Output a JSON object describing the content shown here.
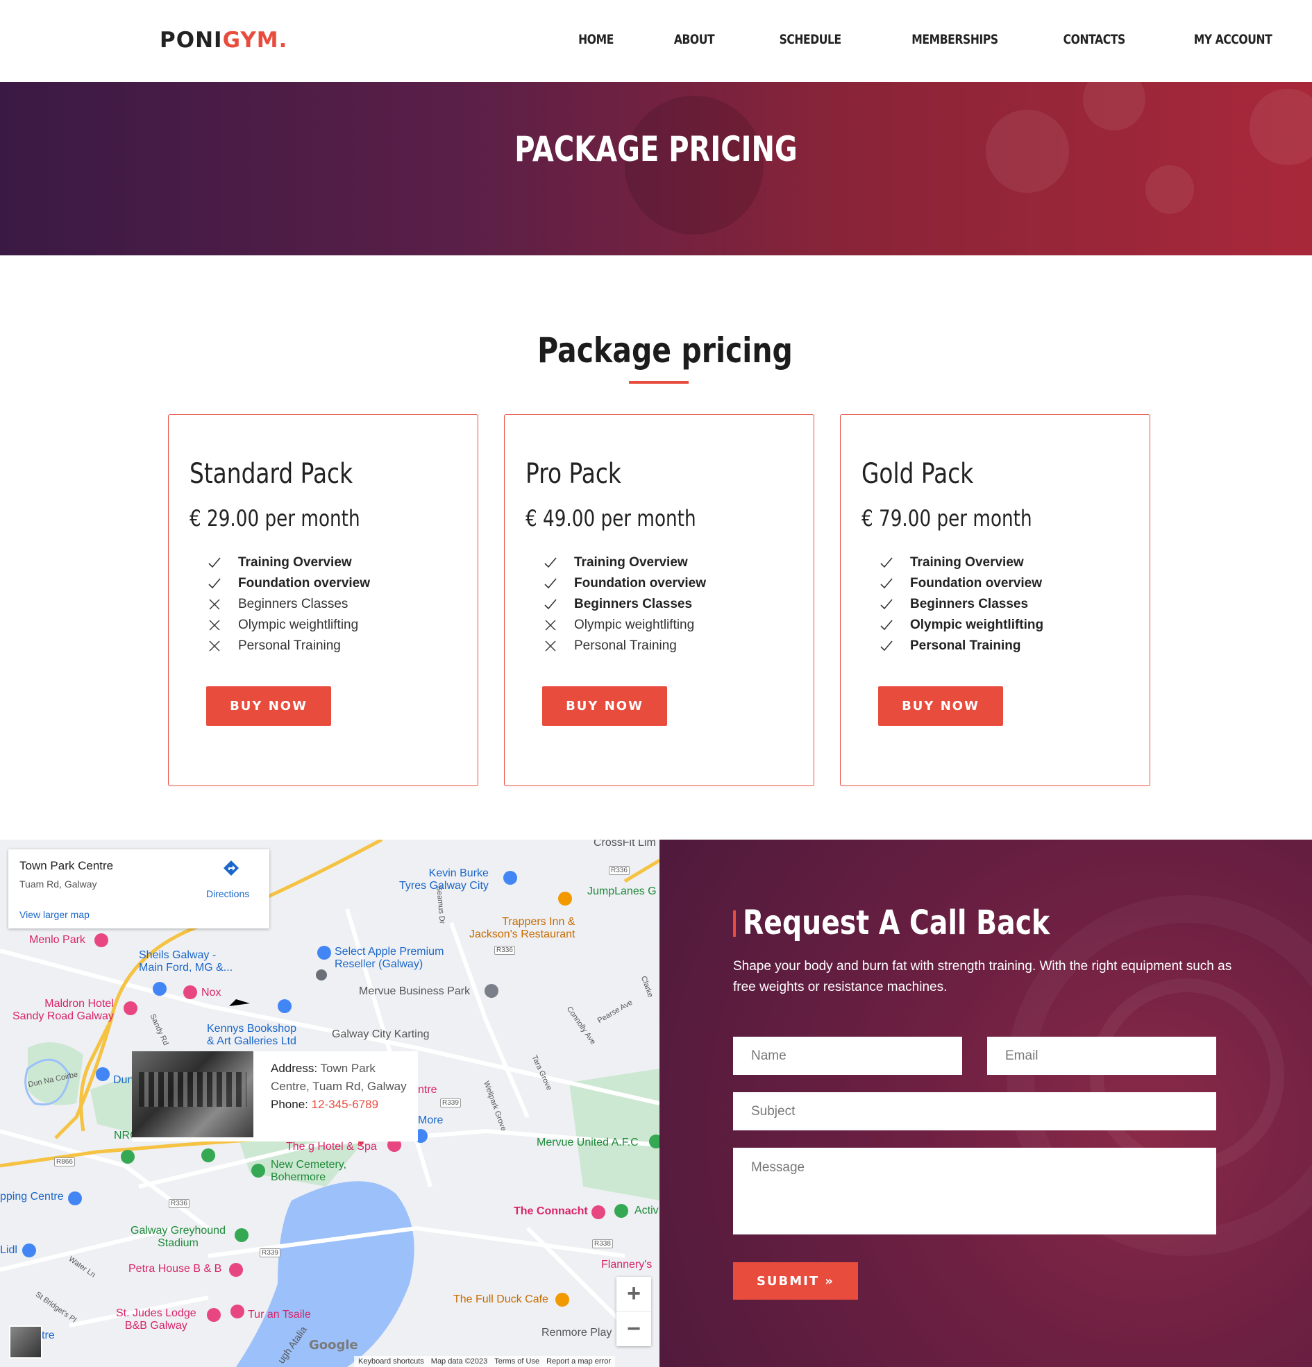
{
  "header": {
    "logo_main": "PONI",
    "logo_accent": "GYM.",
    "nav": [
      "HOME",
      "ABOUT",
      "SCHEDULE",
      "MEMBERSHIPS",
      "CONTACTS",
      "MY ACCOUNT"
    ]
  },
  "hero": {
    "title": "PACKAGE PRICING"
  },
  "pricing": {
    "title": "Package pricing",
    "packages": [
      {
        "name": "Standard Pack",
        "price": "€ 29.00 per month",
        "button": "BUY NOW",
        "features": [
          {
            "label": "Training Overview",
            "included": true
          },
          {
            "label": "Foundation overview",
            "included": true
          },
          {
            "label": "Beginners Classes",
            "included": false
          },
          {
            "label": "Olympic weightlifting",
            "included": false
          },
          {
            "label": "Personal Training",
            "included": false
          }
        ]
      },
      {
        "name": "Pro Pack",
        "price": "€ 49.00 per month",
        "button": "BUY NOW",
        "features": [
          {
            "label": "Training Overview",
            "included": true
          },
          {
            "label": "Foundation overview",
            "included": true
          },
          {
            "label": "Beginners Classes",
            "included": true
          },
          {
            "label": "Olympic weightlifting",
            "included": false
          },
          {
            "label": "Personal Training",
            "included": false
          }
        ]
      },
      {
        "name": "Gold Pack",
        "price": "€ 79.00 per month",
        "button": "BUY NOW",
        "features": [
          {
            "label": "Training Overview",
            "included": true
          },
          {
            "label": "Foundation overview",
            "included": true
          },
          {
            "label": "Beginners Classes",
            "included": true
          },
          {
            "label": "Olympic weightlifting",
            "included": true
          },
          {
            "label": "Personal Training",
            "included": true
          }
        ]
      }
    ]
  },
  "map": {
    "place_name": "Town Park Centre",
    "place_address": "Tuam Rd, Galway",
    "directions": "Directions",
    "view_larger": "View larger map",
    "info_address_label": "Address:",
    "info_address_value": "Town Park Centre, Tuam Rd, Galway",
    "info_phone_label": "Phone:",
    "info_phone_value": "12-345-6789",
    "labels": {
      "kevin_burke": "Kevin Burke\nTyres Galway City",
      "jumplanes": "JumpLanes G",
      "trappers": "Trappers Inn &\nJackson's Restaurant",
      "menlo": "Menlo Park",
      "sheils": "Sheils Galway -\nMain Ford, MG &...",
      "select_apple": "Select Apple Premium\nReseller (Galway)",
      "nox": "Nox",
      "mervue_bp": "Mervue Business Park",
      "maldron": "Maldron Hotel\nSandy Road Galway",
      "kennys": "Kennys Bookshop\n& Art Galleries Ltd",
      "karting": "Galway City Karting",
      "dun": "Dun",
      "ntre": "ntre",
      "more": "More",
      "nrg": "NRG Health & Fitness",
      "gspa": "The g Hotel & Spa",
      "mervue_utd": "Mervue United A.F.C",
      "new_cemetery": "New Cemetery,\nBohermore",
      "shopping": "pping Centre",
      "connacht": "The Connacht",
      "activ": "Activ",
      "greyhound": "Galway Greyhound\nStadium",
      "lidl": "Lidl",
      "petra": "Petra House B & B",
      "flannerys": "Flannery's",
      "full_duck": "The Full Duck Cafe",
      "st_judes": "St. Judes Lodge\nB&B Galway",
      "tur_an": "Tur an Tsaile",
      "renmore": "Renmore Play",
      "tre": "tre",
      "crossfit": "CrossFit Lim",
      "water_ln": "Water Ln",
      "st_bridgets": "St Bridget's Pl",
      "dun_na": "Dun Na Coirbe",
      "sandy_rd": "Sandy Rd",
      "seamus": "Seamus Dr",
      "clarke": "Clarke",
      "pearse": "Pearse Ave",
      "connolly": "Connolly Ave",
      "tara": "Tara Grove",
      "wellpark": "Wellpark Grove",
      "atalia": "ugh Atalia",
      "r336a": "R336",
      "r336b": "R336",
      "r336c": "R336",
      "r866": "R866",
      "r339a": "R339",
      "r339b": "R339",
      "r338": "R338"
    },
    "google": "Google",
    "footer": [
      "Keyboard shortcuts",
      "Map data ©2023",
      "Terms of Use",
      "Report a map error"
    ],
    "zoom_in": "+",
    "zoom_out": "−"
  },
  "callback": {
    "title": "Request A Call Back",
    "description": "Shape your body and burn fat with strength training. With the right equipment such as free weights or resistance machines.",
    "name_placeholder": "Name",
    "email_placeholder": "Email",
    "subject_placeholder": "Subject",
    "message_placeholder": "Message",
    "submit": "SUBMIT »"
  },
  "colors": {
    "accent": "#e84c3d",
    "hero_left": "#3a1a44",
    "hero_right": "#a8283a",
    "text_dark": "#222222"
  }
}
